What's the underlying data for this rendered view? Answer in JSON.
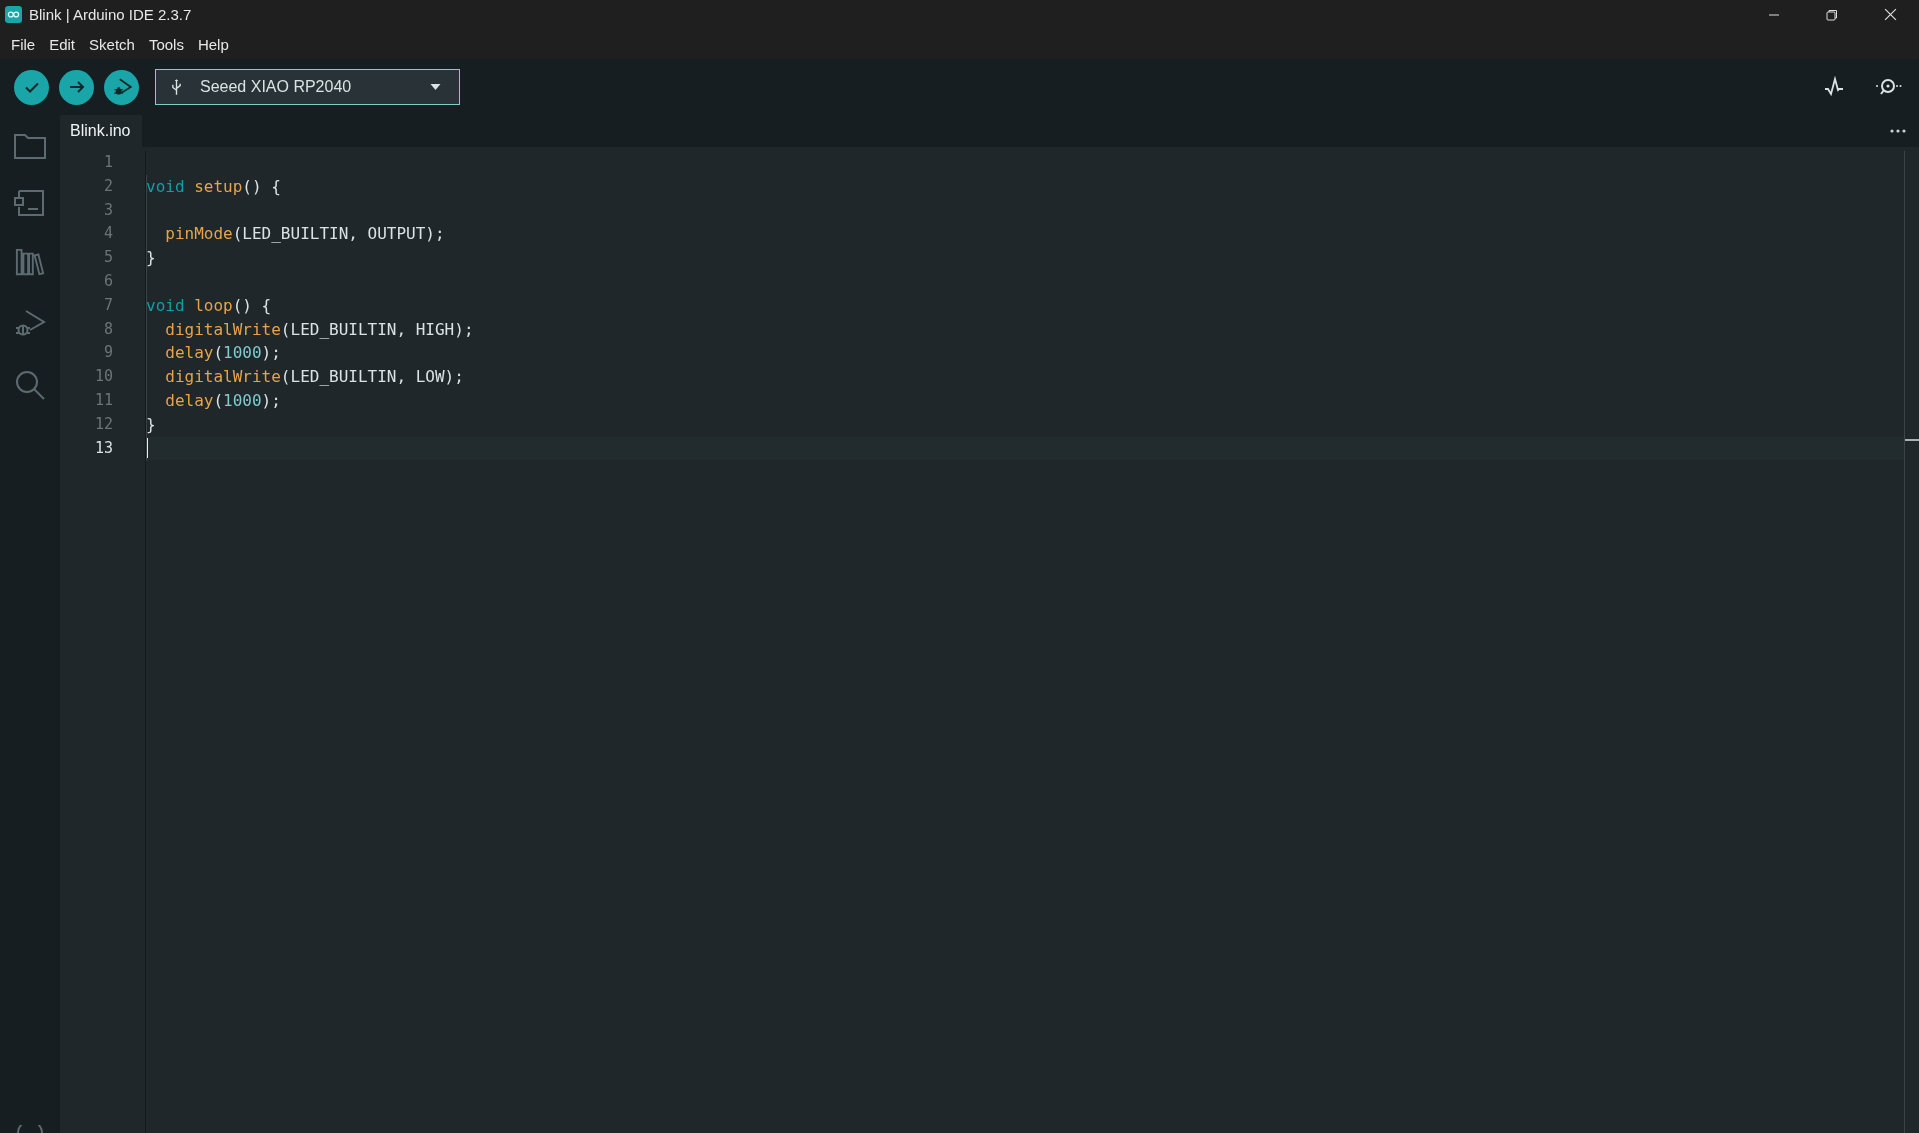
{
  "window": {
    "title": "Blink | Arduino IDE 2.3.7"
  },
  "menu": [
    {
      "label": "File"
    },
    {
      "label": "Edit"
    },
    {
      "label": "Sketch"
    },
    {
      "label": "Tools"
    },
    {
      "label": "Help"
    }
  ],
  "toolbar": {
    "board": "Seeed XIAO RP2040"
  },
  "tabs": [
    {
      "label": "Blink.ino",
      "selected": true
    }
  ],
  "editor": {
    "lines": [
      {
        "number": "1",
        "current": false
      },
      {
        "number": "2",
        "current": false,
        "indent": false,
        "tokens": [
          {
            "text": "void ",
            "kind": "keyword"
          },
          {
            "text": "setup",
            "kind": "function"
          },
          {
            "text": "() {",
            "kind": "plain"
          }
        ]
      },
      {
        "number": "3",
        "current": false
      },
      {
        "number": "4",
        "current": false,
        "indent": true,
        "tokens": [
          {
            "text": "pinMode",
            "kind": "function"
          },
          {
            "text": "(LED_BUILTIN, OUTPUT);",
            "kind": "plain"
          }
        ]
      },
      {
        "number": "5",
        "current": false,
        "indent": false,
        "tokens": [
          {
            "text": "}",
            "kind": "plain"
          }
        ]
      },
      {
        "number": "6",
        "current": false
      },
      {
        "number": "7",
        "current": false,
        "indent": false,
        "tokens": [
          {
            "text": "void ",
            "kind": "keyword"
          },
          {
            "text": "loop",
            "kind": "function"
          },
          {
            "text": "() {",
            "kind": "plain"
          }
        ]
      },
      {
        "number": "8",
        "current": false,
        "indent": true,
        "tokens": [
          {
            "text": "digitalWrite",
            "kind": "function"
          },
          {
            "text": "(LED_BUILTIN, HIGH);",
            "kind": "plain"
          }
        ]
      },
      {
        "number": "9",
        "current": false,
        "indent": true,
        "tokens": [
          {
            "text": "delay",
            "kind": "function"
          },
          {
            "text": "(",
            "kind": "plain"
          },
          {
            "text": "1000",
            "kind": "number"
          },
          {
            "text": ");",
            "kind": "plain"
          }
        ]
      },
      {
        "number": "10",
        "current": false,
        "indent": true,
        "tokens": [
          {
            "text": "digitalWrite",
            "kind": "function"
          },
          {
            "text": "(LED_BUILTIN, LOW);",
            "kind": "plain"
          }
        ]
      },
      {
        "number": "11",
        "current": false,
        "indent": true,
        "tokens": [
          {
            "text": "delay",
            "kind": "function"
          },
          {
            "text": "(",
            "kind": "plain"
          },
          {
            "text": "1000",
            "kind": "number"
          },
          {
            "text": ");",
            "kind": "plain"
          }
        ]
      },
      {
        "number": "12",
        "current": false,
        "indent": false,
        "tokens": [
          {
            "text": "}",
            "kind": "plain"
          }
        ]
      },
      {
        "number": "13",
        "current": true
      }
    ]
  }
}
